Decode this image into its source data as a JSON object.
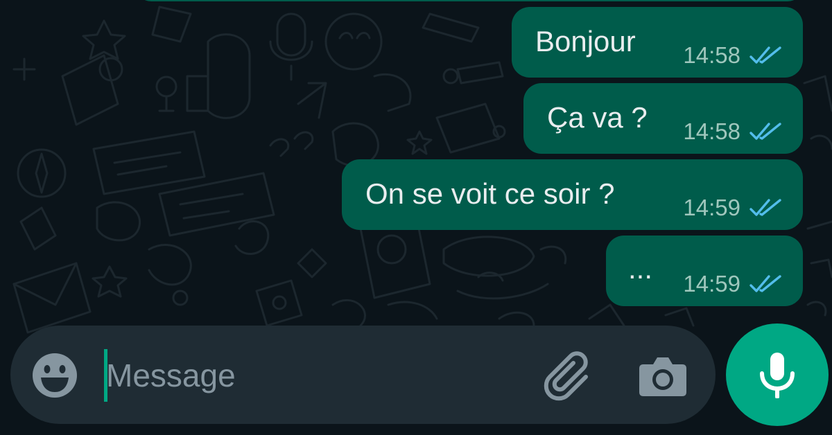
{
  "chat": {
    "messages": [
      {
        "text": "Bonjour",
        "time": "14:58",
        "status": "read"
      },
      {
        "text": "Ça va ?",
        "time": "14:58",
        "status": "read"
      },
      {
        "text": "On se voit ce soir ?",
        "time": "14:59",
        "status": "read"
      },
      {
        "text": "...",
        "time": "14:59",
        "status": "read"
      }
    ]
  },
  "composer": {
    "placeholder": "Message",
    "value": "",
    "icons": {
      "emoji": "emoji-icon",
      "attach": "paperclip-icon",
      "camera": "camera-icon",
      "send": "microphone-icon"
    }
  },
  "colors": {
    "background": "#0b141a",
    "outgoing_bubble": "#005c4b",
    "composer": "#1f2c34",
    "accent": "#00a884",
    "read_ticks": "#53bdeb",
    "timestamp": "#9fc7bd",
    "placeholder": "#8696a0"
  }
}
